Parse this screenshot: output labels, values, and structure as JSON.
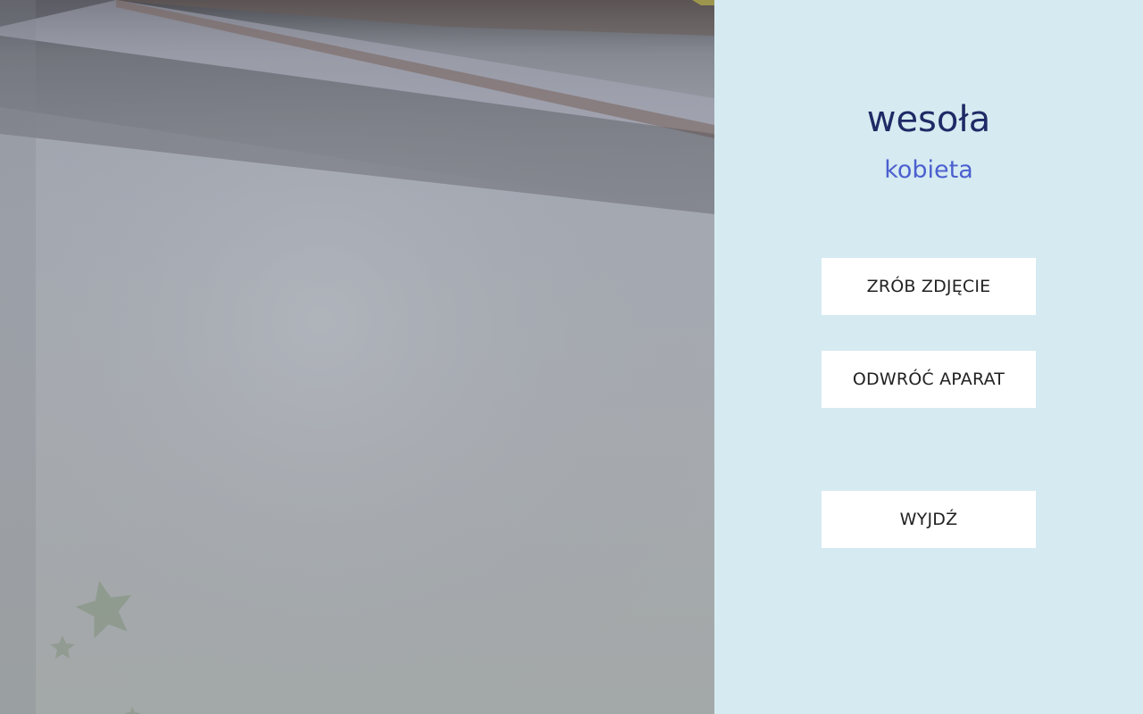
{
  "result": {
    "emotion": "wesoła",
    "gender": "kobieta"
  },
  "buttons": {
    "take_photo": "ZRÓB ZDJĘCIE",
    "flip_camera": "ODWRÓĆ APARAT",
    "exit": "WYJDŹ"
  },
  "colors": {
    "panel_background": "#d5ebf1",
    "emotion_text": "#1f2a66",
    "gender_text": "#4c5fd0",
    "button_background": "#ffffff"
  }
}
